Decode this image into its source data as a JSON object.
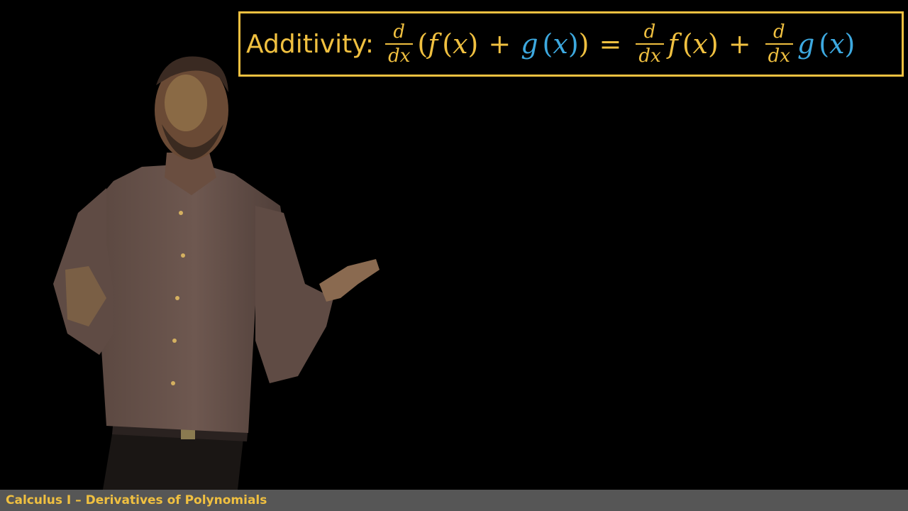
{
  "formula": {
    "label": "Additivity:",
    "d": "d",
    "dx": "dx",
    "f": "f",
    "g": "g",
    "x": "x",
    "open_paren": "(",
    "close_paren": ")",
    "plus": "+",
    "equals": "="
  },
  "footer": {
    "title": "Calculus I – Derivatives of Polynomials"
  },
  "colors": {
    "accent_yellow": "#f0c040",
    "g_blue": "#3da9e0",
    "footer_bar": "#565656",
    "background": "#000000"
  }
}
